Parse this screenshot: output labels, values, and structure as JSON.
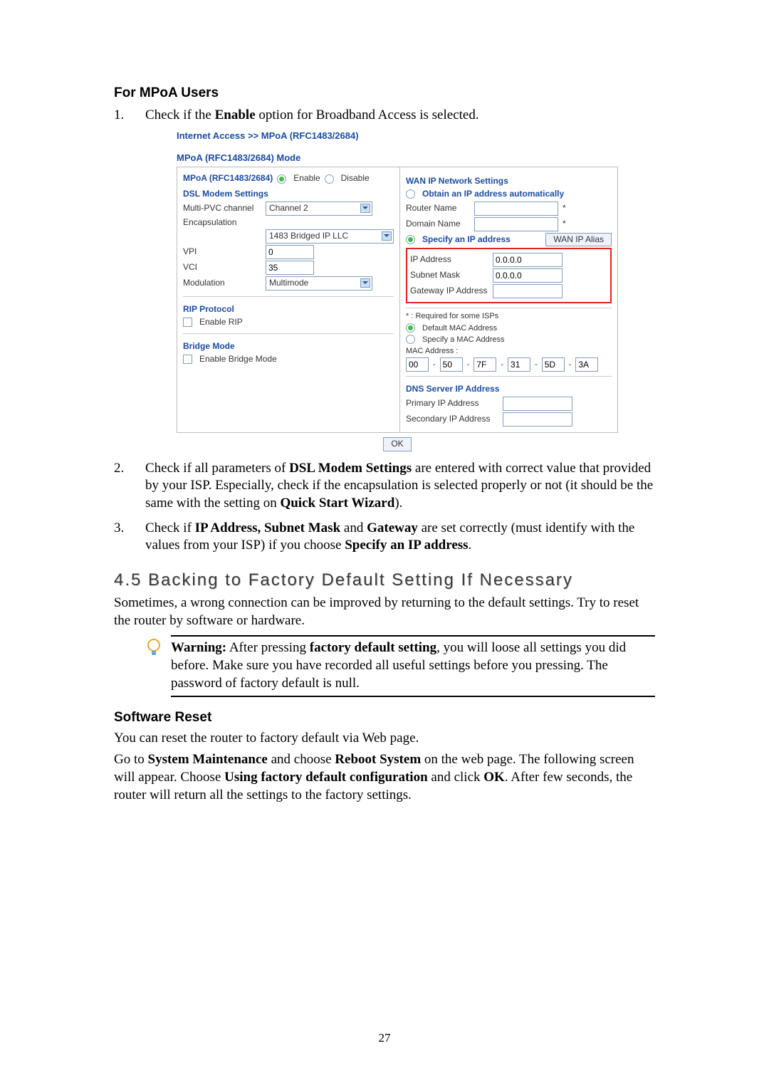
{
  "page_number": "27",
  "mpoa": {
    "heading": "For MPoA Users",
    "item1_pre": "Check if the ",
    "item1_b": "Enable",
    "item1_post": " option for Broadband Access is selected."
  },
  "shot": {
    "breadcrumb": "Internet Access >> MPoA (RFC1483/2684)",
    "mode_title": "MPoA (RFC1483/2684) Mode",
    "mpoa_label": "MPoA (RFC1483/2684)",
    "enable": "Enable",
    "disable": "Disable",
    "dsl_heading": "DSL Modem Settings",
    "multipvc_lbl": "Multi-PVC channel",
    "multipvc_val": "Channel 2",
    "encaps_lbl": "Encapsulation",
    "encaps_val": "1483 Bridged IP LLC",
    "vpi_lbl": "VPI",
    "vpi_val": "0",
    "vci_lbl": "VCI",
    "vci_val": "35",
    "mod_lbl": "Modulation",
    "mod_val": "Multimode",
    "rip_heading": "RIP Protocol",
    "rip_enable": "Enable RIP",
    "bridge_heading": "Bridge Mode",
    "bridge_enable": "Enable Bridge Mode",
    "wan_heading": "WAN IP Network Settings",
    "obtain_auto": "Obtain an IP address automatically",
    "router_name": "Router Name",
    "domain_name": "Domain Name",
    "specify_ip": "Specify an IP address",
    "wan_alias_btn": "WAN IP Alias",
    "ip_lbl": "IP Address",
    "ip_val": "0.0.0.0",
    "subnet_lbl": "Subnet Mask",
    "subnet_val": "0.0.0.0",
    "gw_lbl": "Gateway IP Address",
    "star_note": "* : Required for some ISPs",
    "default_mac": "Default MAC Address",
    "specify_mac": "Specify a MAC Address",
    "mac_lbl": "MAC Address :",
    "mac": [
      "00",
      "50",
      "7F",
      "31",
      "5D",
      "3A"
    ],
    "dns_heading": "DNS Server IP Address",
    "prim_ip": "Primary IP Address",
    "sec_ip": "Secondary IP Address",
    "star": "*",
    "ok": "OK"
  },
  "step2": {
    "pre": "Check if all parameters of ",
    "b1": "DSL Modem Settings",
    "mid1": " are entered with correct value that provided by your ISP. Especially, check if the encapsulation is selected properly or not (it should be the same with the setting on ",
    "b2": "Quick Start Wizard",
    "post": ")."
  },
  "step3": {
    "pre": "Check if ",
    "b1": "IP Address, Subnet Mask",
    "mid1": " and ",
    "b2": "Gateway",
    "mid2": " are set correctly (must identify with the values from your ISP) if you choose ",
    "b3": "Specify an IP address",
    "post": "."
  },
  "sec45": {
    "heading": "4.5 Backing to Factory Default Setting If Necessary",
    "intro": "Sometimes, a wrong connection can be improved by returning to the default settings. Try to reset the router by software or hardware.",
    "warn_b1": "Warning:",
    "warn_mid1": " After pressing ",
    "warn_b2": "factory default setting",
    "warn_post": ", you will loose all settings you did before. Make sure you have recorded all useful settings before you pressing. The password of factory default is null."
  },
  "swreset": {
    "heading": "Software Reset",
    "p1": "You can reset the router to factory default via Web page.",
    "p2_pre": "Go to ",
    "p2_b1": "System Maintenance",
    "p2_mid1": " and choose ",
    "p2_b2": "Reboot System",
    "p2_mid2": " on the web page. The following screen will appear. Choose ",
    "p2_b3": "Using factory default configuration",
    "p2_mid3": " and click ",
    "p2_b4": "OK",
    "p2_post": ". After few seconds, the router will return all the settings to the factory settings."
  }
}
